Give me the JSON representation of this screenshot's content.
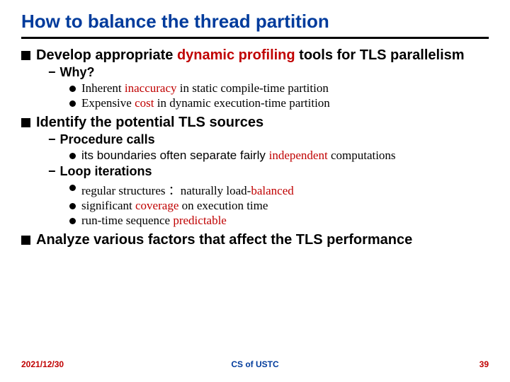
{
  "title": "How to balance the thread partition",
  "p1": {
    "pre": "Develop appropriate ",
    "red": "dynamic profiling",
    "post": " tools for TLS parallelism"
  },
  "why": "Why?",
  "why1": {
    "pre": "Inherent ",
    "red": "inaccuracy",
    "post": " in static compile-time partition"
  },
  "why2": {
    "pre": "Expensive ",
    "red": "cost",
    "post": " in dynamic execution-time partition"
  },
  "p2": "Identify the potential TLS sources",
  "proc": "Procedure calls",
  "proc1": {
    "pre": "its boundaries often separate fairly ",
    "red": "independent",
    "post": " computations"
  },
  "loop": "Loop iterations",
  "loop1": {
    "pre": "regular structures ：naturally load-",
    "red": "balanced",
    "post": ""
  },
  "loop2": {
    "pre": "significant ",
    "red": "coverage",
    "post": " on execution time"
  },
  "loop3": {
    "pre": "run-time sequence ",
    "red": "predictable",
    "post": ""
  },
  "p3": "Analyze various factors that affect the TLS performance",
  "footer": {
    "date": "2021/12/30",
    "center": "CS of USTC",
    "page": "39"
  }
}
